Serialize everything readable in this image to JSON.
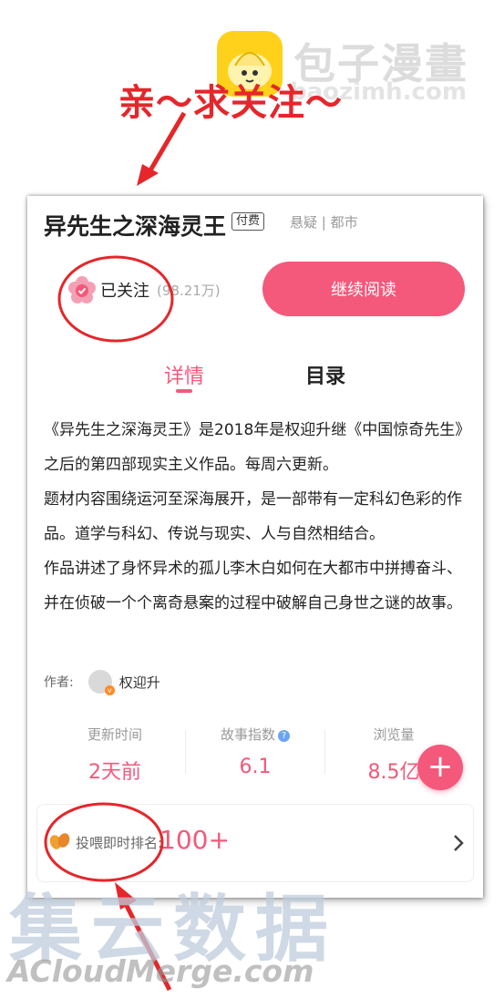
{
  "header": {
    "site_name": "包子漫畫",
    "site_url": "baozimh.com",
    "caption": "亲～求关注～"
  },
  "comic": {
    "title": "异先生之深海灵王",
    "paid_badge": "付费",
    "genre": "悬疑 | 都市",
    "follow_label": "已关注",
    "follow_count": "(98.21万)",
    "read_button": "继续阅读"
  },
  "tabs": {
    "detail": "详情",
    "toc": "目录"
  },
  "description": {
    "p1": "《异先生之深海灵王》是2018年是权迎升继《中国惊奇先生》之后的第四部现实主义作品。每周六更新。",
    "p2": "题材内容围绕运河至深海展开，是一部带有一定科幻色彩的作品。道学与科幻、传说与现实、人与自然相结合。",
    "p3": "作品讲述了身怀异术的孤儿李木白如何在大都市中拼搏奋斗、并在侦破一个个离奇悬案的过程中破解自己身世之谜的故事。"
  },
  "author": {
    "label": "作者:",
    "name": "权迎升"
  },
  "stats": {
    "update_label": "更新时间",
    "update_value": "2天前",
    "index_label": "故事指数",
    "index_value": "6.1",
    "views_label": "浏览量",
    "views_value": "8.5亿"
  },
  "ranking": {
    "label": "投喂即时排名:",
    "value": "100+"
  },
  "watermark": {
    "cn": "集云数据",
    "en": "ACloudMerge.com"
  },
  "colors": {
    "accent": "#f4587a",
    "annotation_red": "#e5262a",
    "logo_yellow": "#ffd11a"
  }
}
